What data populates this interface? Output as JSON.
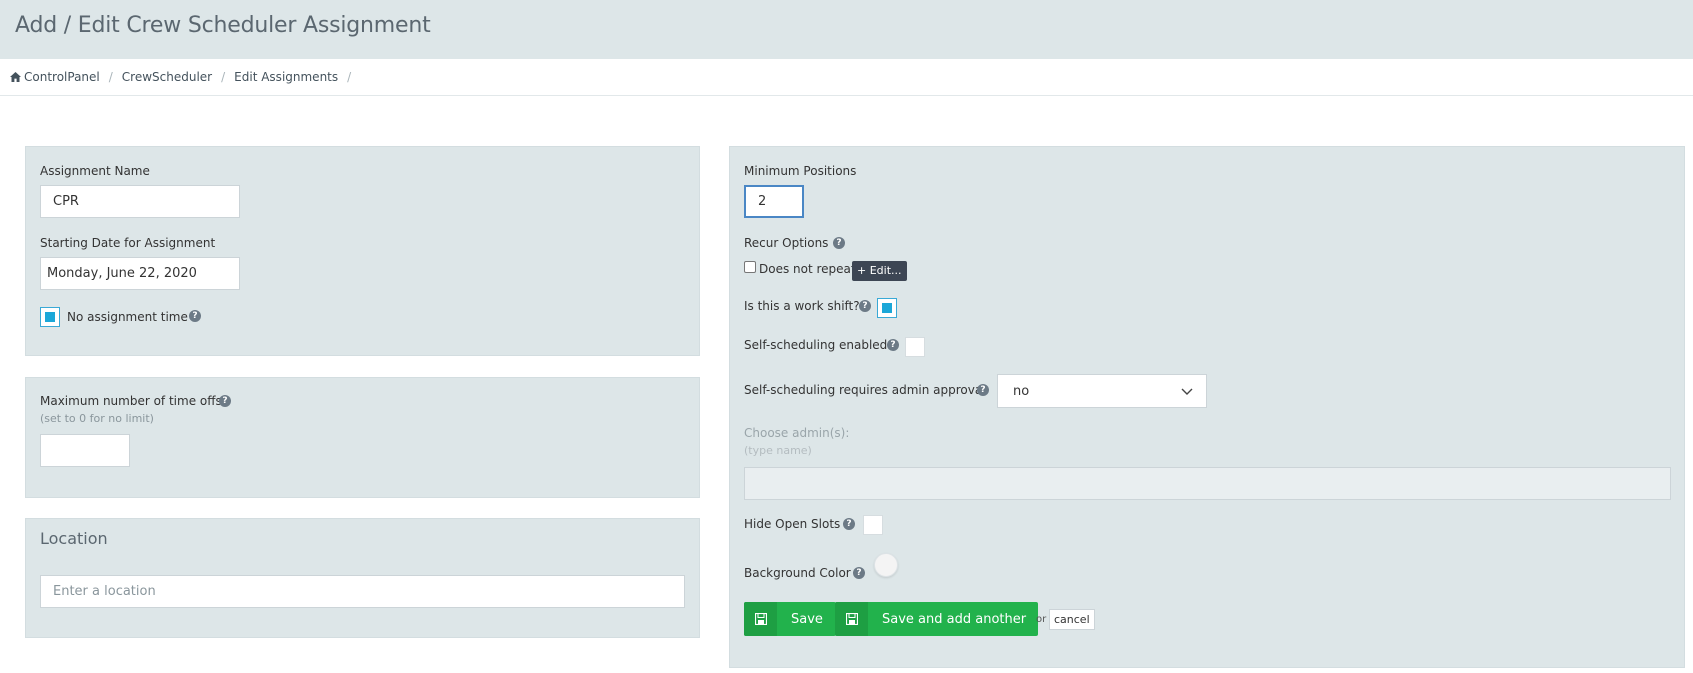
{
  "header": {
    "title": "Add / Edit Crew Scheduler Assignment"
  },
  "breadcrumb": [
    "ControlPanel",
    "CrewScheduler",
    "Edit Assignments"
  ],
  "left": {
    "assignment_name_label": "Assignment Name",
    "assignment_name_value": "CPR",
    "starting_date_label": "Starting Date for Assignment",
    "starting_date_value": "Monday, June 22, 2020",
    "no_assignment_time_label": "No assignment time",
    "no_assignment_time_checked": true,
    "max_timeoffs_label": "Maximum number of time offs",
    "max_timeoffs_hint": "(set to 0 for no limit)",
    "max_timeoffs_value": "",
    "location_title": "Location",
    "location_placeholder": "Enter a location"
  },
  "right": {
    "min_positions_label": "Minimum Positions",
    "min_positions_value": "2",
    "recur_options_label": "Recur Options",
    "does_not_repeat_label": "Does not repeat",
    "edit_button": "+ Edit...",
    "work_shift_label": "Is this a work shift?",
    "work_shift_checked": true,
    "self_scheduling_label": "Self-scheduling enabled",
    "self_scheduling_checked": false,
    "admin_approval_label": "Self-scheduling requires admin approval",
    "admin_approval_value": "no",
    "choose_admins_label": "Choose admin(s):",
    "choose_admins_hint": "(type name)",
    "hide_open_slots_label": "Hide Open Slots",
    "hide_open_slots_checked": false,
    "background_color_label": "Background Color",
    "save_label": "Save",
    "save_add_label": "Save and add another",
    "or_text": "or",
    "cancel_label": "cancel"
  },
  "icons": {
    "help": "?",
    "home": "home-icon",
    "save": "floppy-disk-icon",
    "chevron": "chevron-down-icon"
  },
  "colors": {
    "panel_bg": "#dde6e8",
    "save_green": "#22b24c",
    "check_blue": "#1ba7d8",
    "edit_dark": "#3d4654"
  }
}
